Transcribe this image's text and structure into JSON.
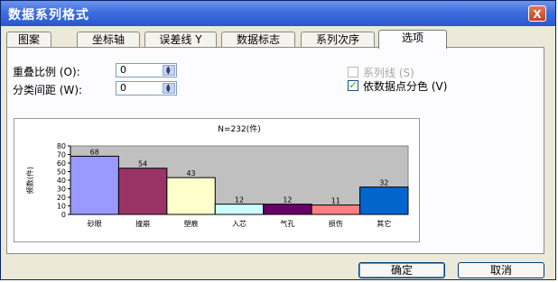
{
  "window": {
    "title": "数据系列格式",
    "close_label": "X"
  },
  "tabs": [
    {
      "label": "图案",
      "active": false
    },
    {
      "label": "坐标轴",
      "active": false
    },
    {
      "label": "误差线 Y",
      "active": false
    },
    {
      "label": "数据标志",
      "active": false
    },
    {
      "label": "系列次序",
      "active": false
    },
    {
      "label": "选项",
      "active": true
    }
  ],
  "options": {
    "overlap": {
      "label": "重叠比例 (O):",
      "value": "0"
    },
    "gap": {
      "label": "分类间距 (W):",
      "value": "0"
    },
    "series_lines": {
      "label": "系列线 (S)",
      "checked": false,
      "disabled": true
    },
    "vary_colors": {
      "label": "依数据点分色 (V)",
      "checked": true,
      "disabled": false
    }
  },
  "chart_data": {
    "type": "bar",
    "title": "N=232(件)",
    "ylabel": "频数(件)",
    "xlabel": "",
    "categories": [
      "砂眼",
      "撞崩",
      "塑痕",
      "入芯",
      "气孔",
      "损伤",
      "其它"
    ],
    "values": [
      68,
      54,
      43,
      12,
      12,
      11,
      32
    ],
    "ylim": [
      0,
      80
    ],
    "yticks": [
      0,
      10,
      20,
      30,
      40,
      50,
      60,
      70,
      80
    ],
    "colors": [
      "#9999ff",
      "#993366",
      "#ffffcc",
      "#ccffff",
      "#660066",
      "#ff8080",
      "#0066cc"
    ],
    "plot_background": "#c0c0c0",
    "grid": false,
    "data_labels": true
  },
  "buttons": {
    "ok": "确定",
    "cancel": "取消"
  }
}
